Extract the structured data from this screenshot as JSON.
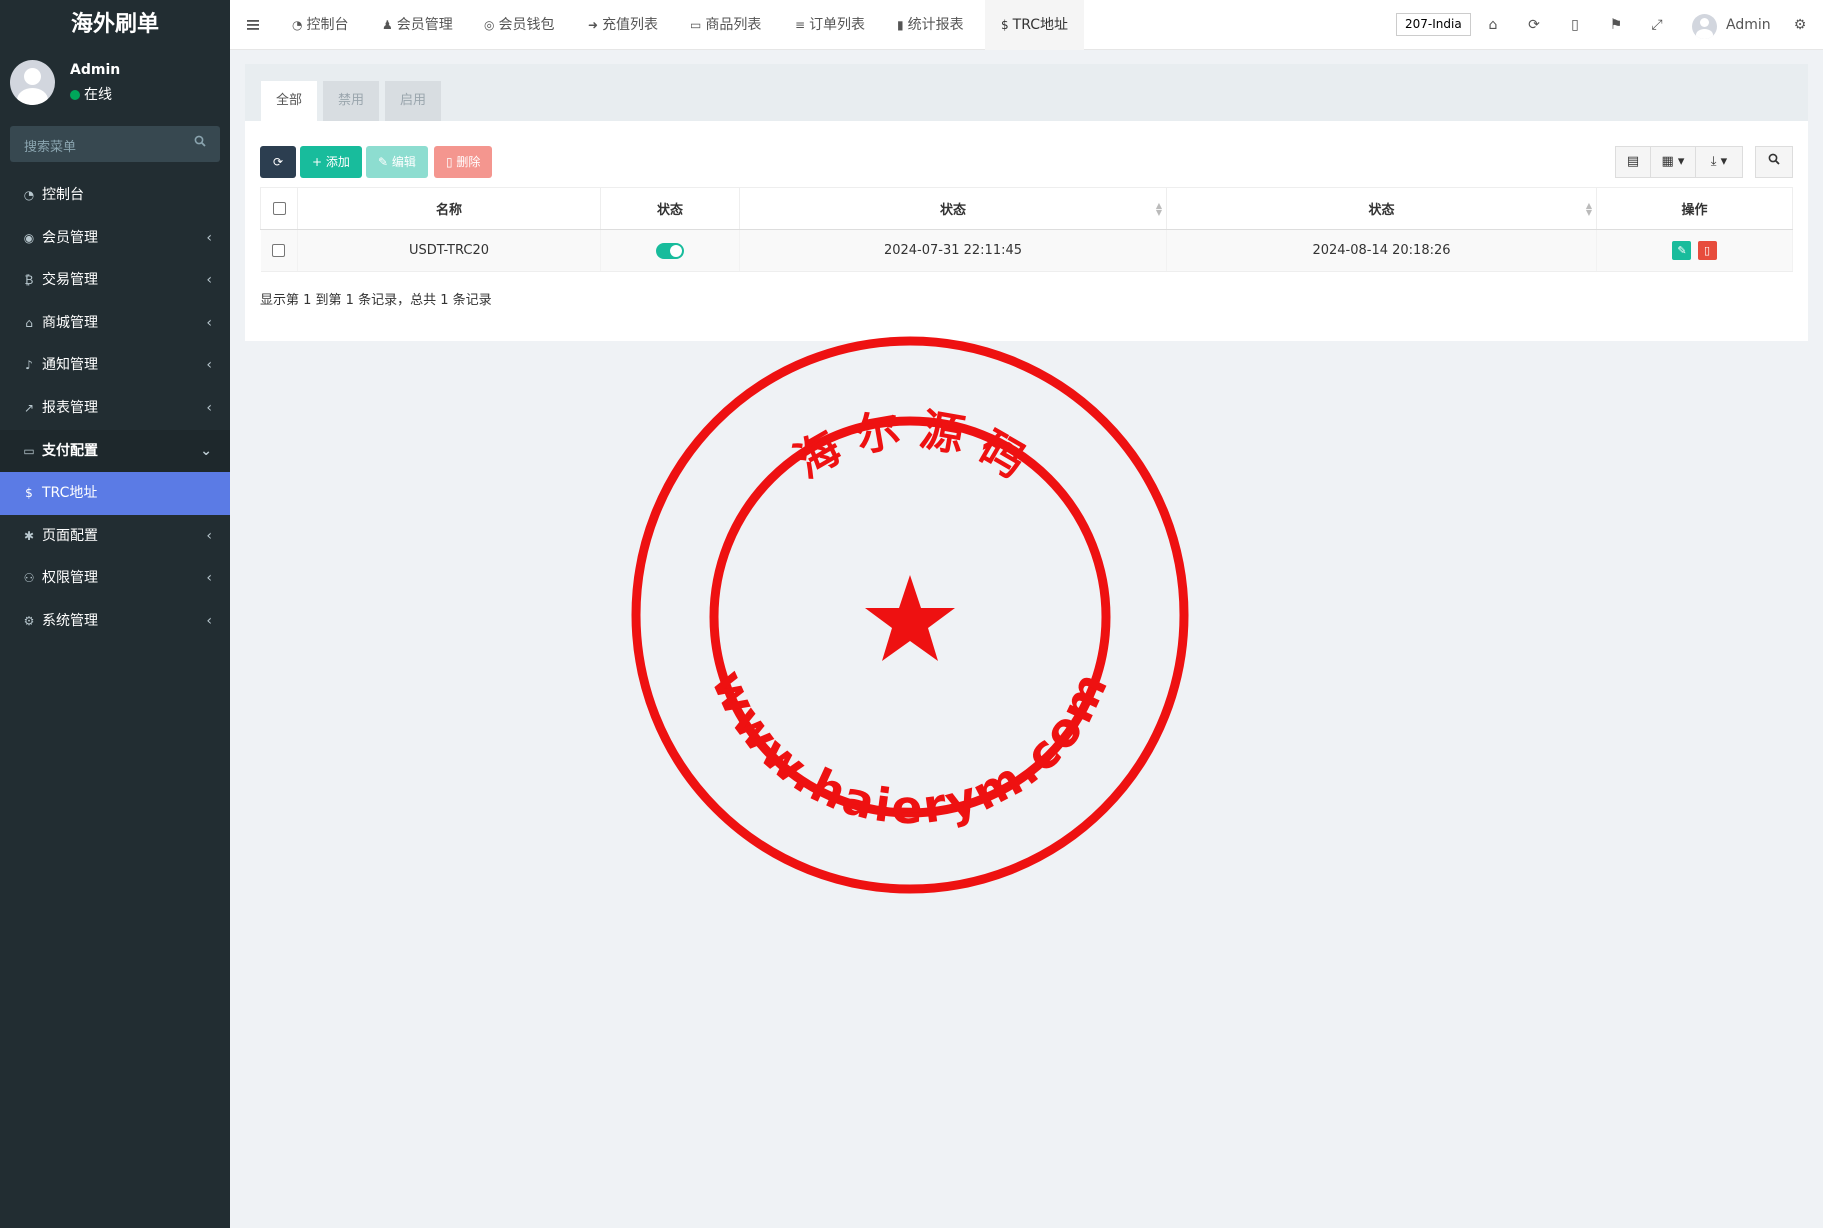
{
  "sidebar": {
    "brand": "海外刷单",
    "user": {
      "name": "Admin",
      "status": "在线"
    },
    "search_placeholder": "搜索菜单",
    "items": [
      {
        "label": "控制台",
        "icon": "dashboard-icon",
        "has_arrow": false
      },
      {
        "label": "会员管理",
        "icon": "user-circle-icon",
        "has_arrow": true
      },
      {
        "label": "交易管理",
        "icon": "bitcoin-icon",
        "has_arrow": true
      },
      {
        "label": "商城管理",
        "icon": "home-icon",
        "has_arrow": true
      },
      {
        "label": "通知管理",
        "icon": "bell-icon",
        "has_arrow": true
      },
      {
        "label": "报表管理",
        "icon": "line-chart-icon",
        "has_arrow": true
      },
      {
        "label": "支付配置",
        "icon": "credit-card-icon",
        "has_arrow": true,
        "open": true
      },
      {
        "label": "TRC地址",
        "icon": "dollar-icon",
        "active": true
      },
      {
        "label": "页面配置",
        "icon": "gear-icon",
        "has_arrow": true
      },
      {
        "label": "权限管理",
        "icon": "users-icon",
        "has_arrow": true
      },
      {
        "label": "系统管理",
        "icon": "gears-icon",
        "has_arrow": true
      }
    ]
  },
  "header": {
    "tabs": [
      {
        "label": "控制台",
        "icon": "dashboard-icon"
      },
      {
        "label": "会员管理",
        "icon": "user-icon"
      },
      {
        "label": "会员钱包",
        "icon": "wallet-icon"
      },
      {
        "label": "充值列表",
        "icon": "sign-in-icon"
      },
      {
        "label": "商品列表",
        "icon": "desktop-icon"
      },
      {
        "label": "订单列表",
        "icon": "list-icon"
      },
      {
        "label": "统计报表",
        "icon": "bar-chart-icon"
      },
      {
        "label": "TRC地址",
        "icon": "dollar-icon",
        "active": true
      }
    ],
    "lang_badge": "207-India",
    "username": "Admin"
  },
  "content": {
    "tabs": [
      "全部",
      "禁用",
      "启用"
    ],
    "active_tab": "全部",
    "toolbar": {
      "add_label": "添加",
      "edit_label": "编辑",
      "delete_label": "删除"
    },
    "table": {
      "columns": [
        "名称",
        "状态",
        "状态",
        "状态",
        "操作"
      ],
      "rows": [
        {
          "name": "USDT-TRC20",
          "enabled": true,
          "created": "2024-07-31 22:11:45",
          "updated": "2024-08-14 20:18:26"
        }
      ]
    },
    "pagination_info": "显示第 1 到第 1 条记录，总共 1 条记录"
  },
  "watermark": {
    "top_text": "海 尔 源 码",
    "bottom_text": "www.haierym.com",
    "color": "#ee1111"
  },
  "colors": {
    "sidebar_bg": "#222d32",
    "active_menu": "#5b7be5",
    "success": "#18bc9c",
    "danger": "#e74c3c",
    "primary_dark": "#2c3e50"
  }
}
